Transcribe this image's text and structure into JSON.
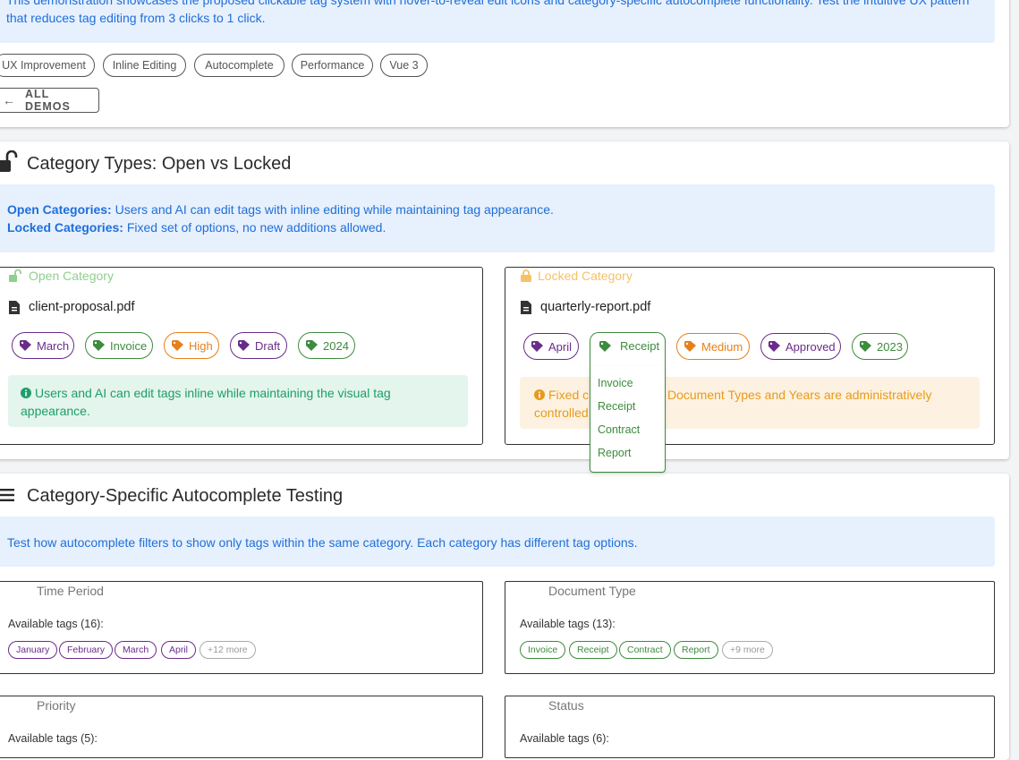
{
  "intro": {
    "text": "This demonstration showcases the proposed clickable tag system with hover-to-reveal edit icons and category-specific autocomplete functionality. Test the intuitive UX pattern that reduces tag editing from 3 clicks to 1 click.",
    "chips": [
      "UX Improvement",
      "Inline Editing",
      "Autocomplete",
      "Performance",
      "Vue 3"
    ],
    "all_demos_label": "ALL DEMOS"
  },
  "category_types": {
    "title": "Category Types: Open vs Locked",
    "open_label": "Open Categories:",
    "open_desc": "Users and AI can edit tags with inline editing while maintaining tag appearance.",
    "locked_label": "Locked Categories:",
    "locked_desc": "Fixed set of options, no new additions allowed.",
    "open_panel": {
      "header": "Open Category",
      "filename": "client-proposal.pdf",
      "tags": [
        {
          "label": "March",
          "color": "purple"
        },
        {
          "label": "Invoice",
          "color": "green"
        },
        {
          "label": "High",
          "color": "orange"
        },
        {
          "label": "Draft",
          "color": "purple"
        },
        {
          "label": "2024",
          "color": "green"
        }
      ],
      "note": "Users and AI can edit tags inline while maintaining the visual tag appearance."
    },
    "locked_panel": {
      "header": "Locked Category",
      "filename": "quarterly-report.pdf",
      "tags": [
        {
          "label": "April",
          "color": "purple"
        },
        {
          "label": "Receipt",
          "color": "green"
        },
        {
          "label": "Medium",
          "color": "orange"
        },
        {
          "label": "Approved",
          "color": "purple"
        },
        {
          "label": "2023",
          "color": "green"
        }
      ],
      "note_part1": "Fixed c",
      "note_part2": "Document Types and Years are administratively",
      "note_line2": "controlled",
      "dropdown_options": [
        "Invoice",
        "Receipt",
        "Contract",
        "Report"
      ]
    }
  },
  "autocomplete": {
    "title": "Category-Specific Autocomplete Testing",
    "desc": "Test how autocomplete filters to show only tags within the same category. Each category has different tag options.",
    "categories": [
      {
        "name": "Time Period",
        "available": "Available tags (16):",
        "tags": [
          "January",
          "February",
          "March",
          "April"
        ],
        "more": "+12 more",
        "color": "purple"
      },
      {
        "name": "Document Type",
        "available": "Available tags (13):",
        "tags": [
          "Invoice",
          "Receipt",
          "Contract",
          "Report"
        ],
        "more": "+9 more",
        "color": "green"
      },
      {
        "name": "Priority",
        "available": "Available tags (5):"
      },
      {
        "name": "Status",
        "available": "Available tags (6):"
      }
    ]
  },
  "colors": {
    "purple": "#6a2c8a",
    "green": "#3d8b3d",
    "orange": "#e6801a",
    "blue": "#1e6fd9"
  }
}
